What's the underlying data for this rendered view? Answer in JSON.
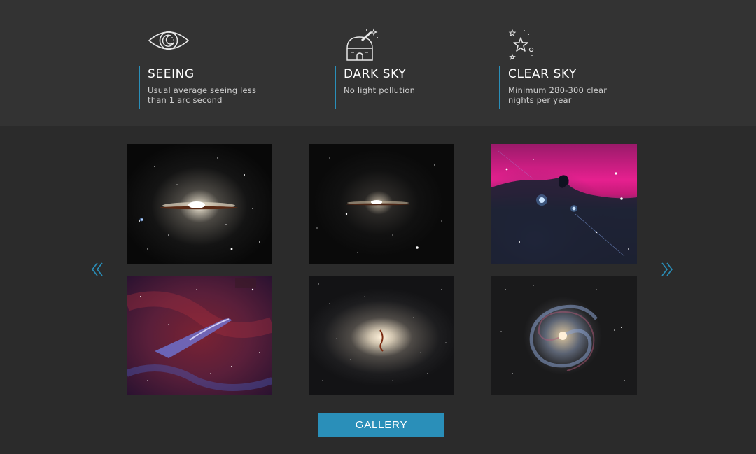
{
  "features": [
    {
      "icon": "eye-moon-icon",
      "title": "SEEING",
      "description": "Usual average seeing less than 1 arc second"
    },
    {
      "icon": "observatory-icon",
      "title": "DARK SKY",
      "description": "No light pollution"
    },
    {
      "icon": "stars-icon",
      "title": "CLEAR SKY",
      "description": "Minimum 280-300 clear nights per year"
    }
  ],
  "gallery": {
    "images": [
      {
        "subject": "sombrero-galaxy",
        "variant": "color"
      },
      {
        "subject": "sombrero-galaxy",
        "variant": "dark"
      },
      {
        "subject": "horsehead-nebula"
      },
      {
        "subject": "pencil-nebula"
      },
      {
        "subject": "elliptical-galaxy"
      },
      {
        "subject": "spiral-galaxy"
      }
    ],
    "prev_icon": "chevron-double-left-icon",
    "next_icon": "chevron-double-right-icon",
    "button_label": "GALLERY"
  },
  "colors": {
    "accent": "#2a8fb9",
    "header_bg": "#333333",
    "page_bg": "#2b2b2b"
  }
}
